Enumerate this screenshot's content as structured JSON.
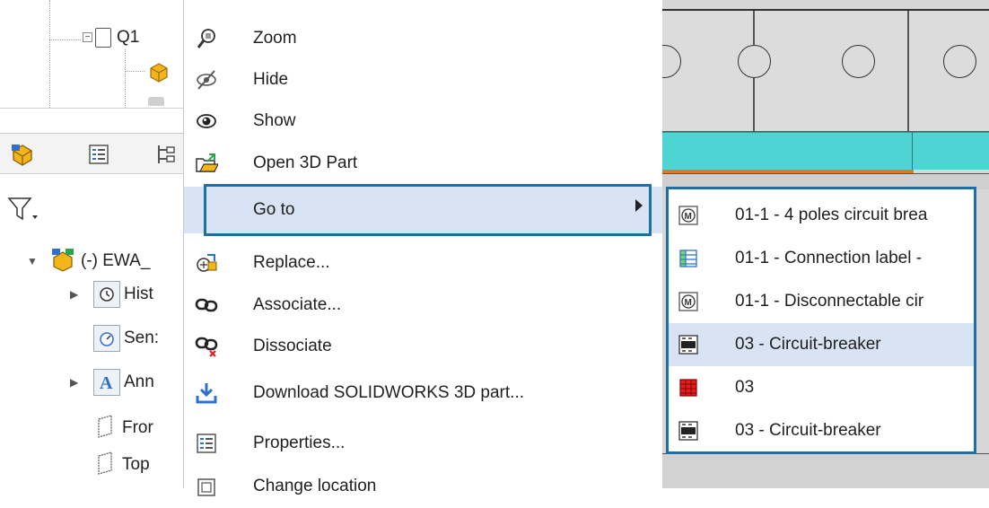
{
  "tree": {
    "q1_label": "Q1",
    "root_label": "(-) EWA_",
    "nodes": [
      {
        "label": "Hist",
        "icon": "history-icon",
        "expandable": true
      },
      {
        "label": "Sen:",
        "icon": "sensors-icon",
        "expandable": false
      },
      {
        "label": "Ann",
        "icon": "annotations-icon",
        "expandable": true
      },
      {
        "label": "Fror",
        "icon": "front-plane-icon",
        "expandable": false
      },
      {
        "label": "Top",
        "icon": "top-plane-icon",
        "expandable": false
      }
    ]
  },
  "context_menu": {
    "items": [
      {
        "label": "Zoom",
        "icon": "zoom-icon"
      },
      {
        "label": "Hide",
        "icon": "hide-icon"
      },
      {
        "label": "Show",
        "icon": "show-icon"
      },
      {
        "label": "Open 3D Part",
        "icon": "open-3d-part-icon"
      },
      {
        "label": "Go to",
        "icon": "",
        "highlighted": true,
        "has_submenu": true
      },
      {
        "label": "Replace...",
        "icon": "replace-icon"
      },
      {
        "label": "Associate...",
        "icon": "associate-icon"
      },
      {
        "label": "Dissociate",
        "icon": "dissociate-icon"
      },
      {
        "label": "Download SOLIDWORKS 3D part...",
        "icon": "download-icon"
      },
      {
        "label": "Properties...",
        "icon": "properties-icon"
      },
      {
        "label": "Change location",
        "icon": "change-location-icon"
      }
    ]
  },
  "submenu": {
    "items": [
      {
        "label": "01-1 - 4 poles circuit brea",
        "icon": "motor-symbol-icon"
      },
      {
        "label": "01-1 - Connection label -",
        "icon": "connection-label-icon"
      },
      {
        "label": "01-1 - Disconnectable cir",
        "icon": "motor-symbol-icon"
      },
      {
        "label": "03 - Circuit-breaker",
        "icon": "circuit-breaker-icon",
        "highlighted": true
      },
      {
        "label": "03",
        "icon": "red-terminal-icon"
      },
      {
        "label": "03 - Circuit-breaker",
        "icon": "circuit-breaker-icon"
      }
    ]
  },
  "colors": {
    "accent_border": "#1e6fa8",
    "highlight": "#d8e3f3",
    "bus_cyan": "#4fd4d4",
    "orange_line": "#e07b1a"
  }
}
